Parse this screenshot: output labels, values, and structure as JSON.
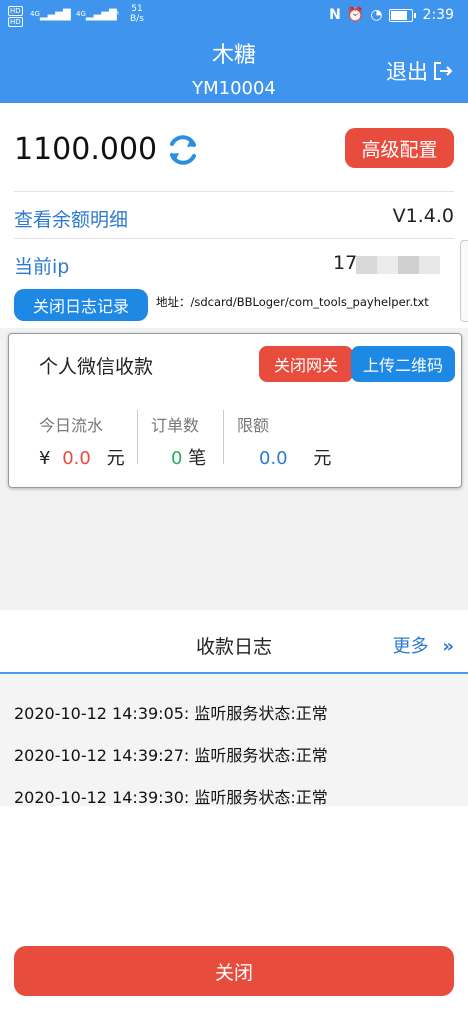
{
  "status_bar": {
    "hd1": "HD",
    "hd2": "HD",
    "net1": "4G",
    "net2": "4G",
    "speed_value": "51",
    "speed_unit": "B/s",
    "nfc": "N",
    "time": "2:39"
  },
  "header": {
    "title": "木糖",
    "subtitle": "YM10004",
    "logout_label": "退出"
  },
  "balance": {
    "amount": "1100.000",
    "advanced_config_label": "高级配置"
  },
  "info": {
    "detail_link": "查看余额明细",
    "version": "V1.4.0",
    "ip_label": "当前ip",
    "ip_value": "17",
    "close_log_label": "关闭日志记录",
    "log_path": "地址：/sdcard/BBLoger/com_tools_payhelper.txt"
  },
  "card": {
    "title": "个人微信收款",
    "close_gateway_label": "关闭网关",
    "upload_qr_label": "上传二维码",
    "stats": {
      "today_flow_label": "今日流水",
      "currency": "¥",
      "today_flow_value": "0.0",
      "yuan": "元",
      "orders_label": "订单数",
      "orders_value": "0",
      "orders_unit": "笔",
      "limit_label": "限额",
      "limit_value": "0.0",
      "limit_unit": "元"
    }
  },
  "log": {
    "title": "收款日志",
    "more_label": "更多",
    "entries": [
      "2020-10-12 14:39:05: 监听服务状态:正常",
      "2020-10-12 14:39:27: 监听服务状态:正常",
      "2020-10-12 14:39:30: 监听服务状态:正常"
    ]
  },
  "footer": {
    "close_label": "关闭"
  },
  "colors": {
    "header_blue": "#3f95ee",
    "red": "#e84c3d",
    "blue_button": "#1e88e5",
    "link_blue": "#2d7bd0",
    "green": "#27ae60"
  }
}
